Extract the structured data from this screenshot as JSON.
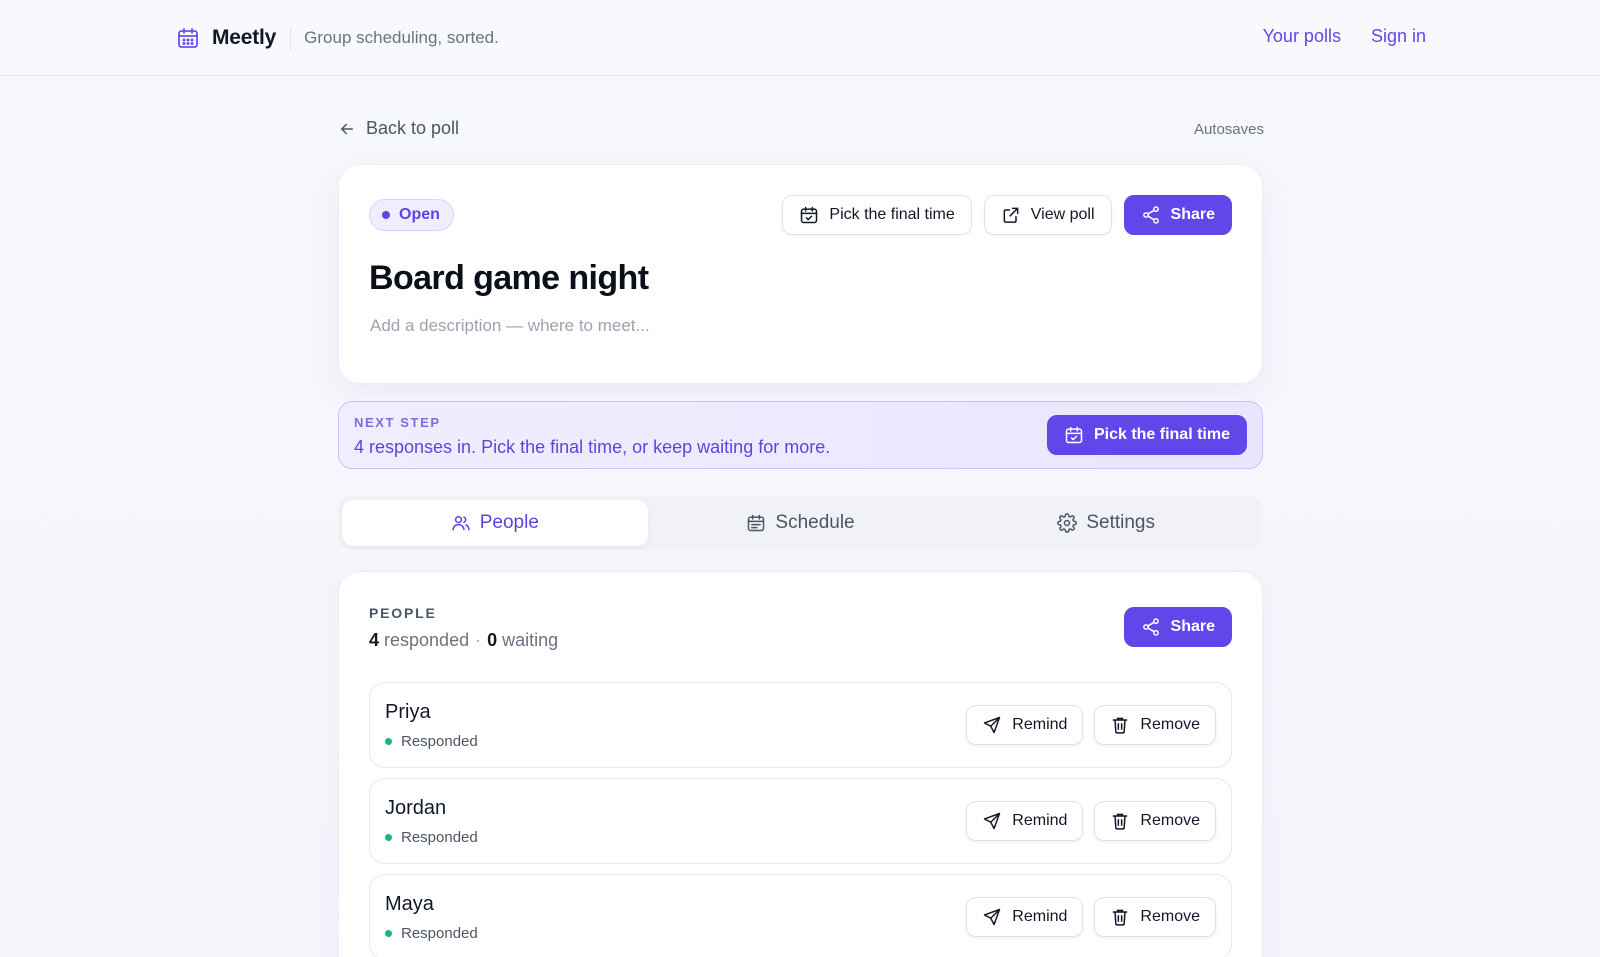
{
  "header": {
    "brand_icon": "calendar-icon",
    "brand_name": "Meetly",
    "tagline": "Group scheduling, sorted.",
    "nav": {
      "your_polls": "Your polls",
      "sign_in": "Sign in"
    }
  },
  "toolbar": {
    "back_label": "Back to poll",
    "autosave_label": "Autosaves"
  },
  "poll": {
    "status": "Open",
    "title": "Board game night",
    "description_placeholder": "Add a description — where to meet...",
    "actions": {
      "pick_final_time": "Pick the final time",
      "view_poll": "View poll",
      "share": "Share"
    }
  },
  "next_step": {
    "label": "NEXT STEP",
    "text": "4 responses in. Pick the final time, or keep waiting for more.",
    "button": "Pick the final time"
  },
  "tabs": [
    {
      "label": "People",
      "icon": "users-icon",
      "active": true
    },
    {
      "label": "Schedule",
      "icon": "calendar-icon",
      "active": false
    },
    {
      "label": "Settings",
      "icon": "gear-icon",
      "active": false
    }
  ],
  "people": {
    "section_label": "PEOPLE",
    "responded_count": "4",
    "responded_label": "responded",
    "separator": "·",
    "waiting_count": "0",
    "waiting_label": "waiting",
    "share_label": "Share",
    "remind_label": "Remind",
    "remove_label": "Remove",
    "list": [
      {
        "name": "Priya",
        "status": "Responded"
      },
      {
        "name": "Jordan",
        "status": "Responded"
      },
      {
        "name": "Maya",
        "status": "Responded"
      }
    ]
  },
  "colors": {
    "accent": "#6047ea",
    "accent_text": "#5b45e0",
    "responded_dot": "#10b981"
  }
}
